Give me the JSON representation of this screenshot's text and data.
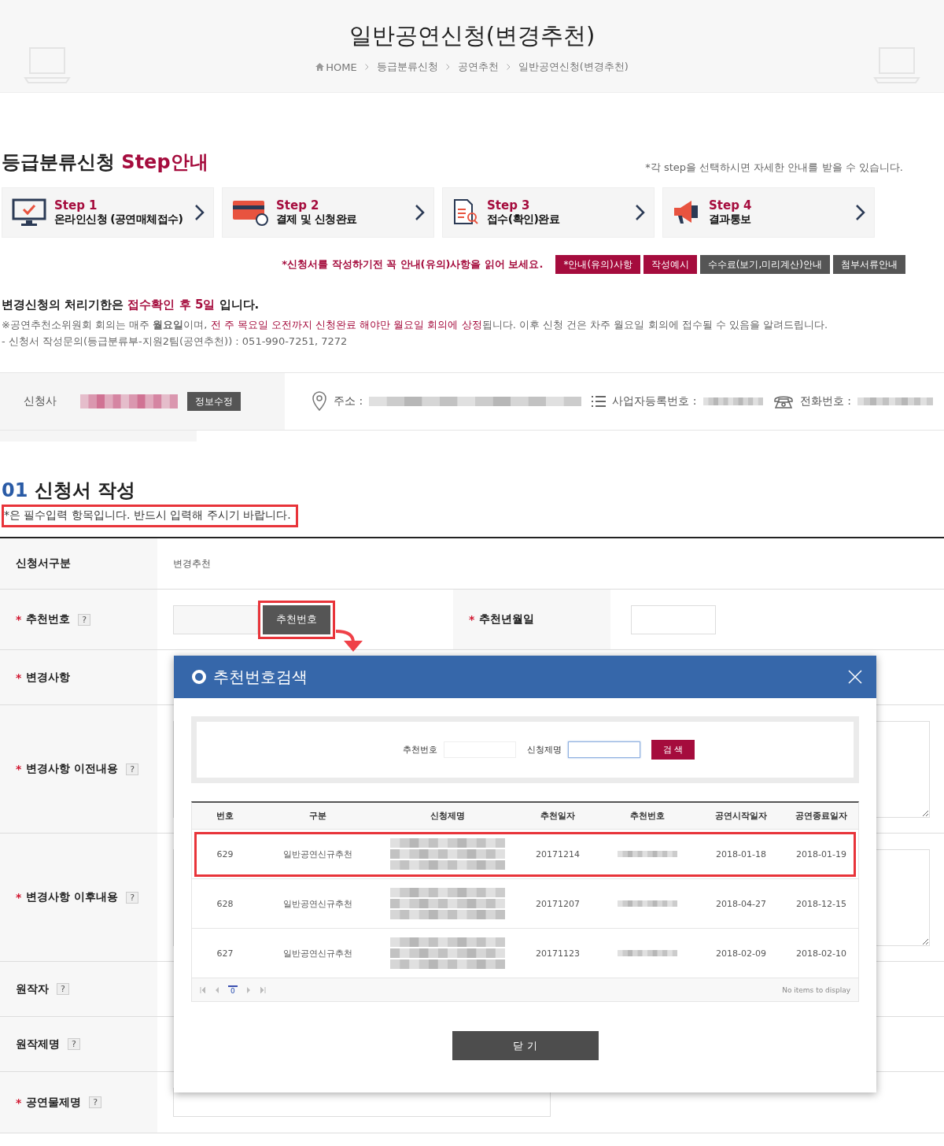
{
  "header": {
    "title": "일반공연신청(변경추천)",
    "breadcrumb": [
      "HOME",
      "등급분류신청",
      "공연추천",
      "일반공연신청(변경추천)"
    ]
  },
  "steps_section": {
    "title": "등급분류신청",
    "title_accent": "Step안내",
    "note": "*각 step을 선택하시면 자세한 안내를 받을 수 있습니다.",
    "steps": [
      {
        "kind": "monitor",
        "step": "Step 1",
        "label": "온라인신청 (공연매체접수)"
      },
      {
        "kind": "card",
        "step": "Step 2",
        "label": "결제 및 신청완료"
      },
      {
        "kind": "document",
        "step": "Step 3",
        "label": "접수(확인)완료"
      },
      {
        "kind": "megaphone",
        "step": "Step 4",
        "label": "결과통보"
      }
    ]
  },
  "notice": {
    "text": "*신청서를 작성하기전 꼭 안내(유의)사항을 읽어 보세요.",
    "buttons": [
      {
        "label": "*안내(유의)사항",
        "kind": "primary"
      },
      {
        "label": "작성예시",
        "kind": "primary"
      },
      {
        "label": "수수료(보기,미리계산)안내",
        "kind": "dark"
      },
      {
        "label": "첨부서류안내",
        "kind": "dark"
      }
    ]
  },
  "deadline": {
    "before": "변경신청의 처리기한은 ",
    "accent": "접수확인 후 5일",
    "after": " 입니다."
  },
  "info_lines": [
    {
      "segments": [
        {
          "text": "※공연추천소위원회 회의는 매주 **월요일**이며, ",
          "accent": false
        },
        {
          "text": "전 주 목요일 오전까지 신청완료 해야만 월요일 회의에 상정",
          "accent": true
        },
        {
          "text": "됩니다. 이후 신청 건은 차주 월요일 회의에 접수될 수 있음을 알려드립니다.",
          "accent": false
        }
      ]
    },
    {
      "segments": [
        {
          "text": "- 신청서 작성문의(등급분류부-지원2팀(공연추천)) : 051-990-7251, 7272",
          "accent": false
        }
      ]
    }
  ],
  "applicant": {
    "label": "신청사",
    "edit_button": "정보수정",
    "address_label": "주소 :",
    "biz_label": "사업자등록번호 :",
    "phone_label": "전화번호 :"
  },
  "form": {
    "number": "01",
    "title": "신청서 작성",
    "required_note": {
      "text": "*은 필수입력 항목입니다. 반드시 입력해 주시기 바랍니다.",
      "highlighted": true
    },
    "rows": [
      {
        "kind": "text",
        "label": "신청서구분",
        "value": "변경추천"
      },
      {
        "kind": "lookup",
        "mark": "*",
        "label": "추천번호",
        "help": "?",
        "button": {
          "label": "추천번호",
          "highlighted": true
        },
        "side_mark": "*",
        "side_label": "추천년월일"
      },
      {
        "kind": "blank",
        "mark": "*",
        "label": "변경사항"
      },
      {
        "kind": "textarea",
        "mark": "*",
        "label": "변경사항 이전내용",
        "help": "?"
      },
      {
        "kind": "textarea",
        "mark": "*",
        "label": "변경사항 이후내용",
        "help": "?"
      },
      {
        "kind": "blank",
        "label": "원작자",
        "help": "?"
      },
      {
        "kind": "blank",
        "label": "원작제명",
        "help": "?"
      },
      {
        "kind": "input",
        "mark": "*",
        "label": "공연물제명",
        "help": "?"
      }
    ]
  },
  "modal": {
    "title": "추천번호검색",
    "search": {
      "fields": [
        {
          "label": "추천번호",
          "focused": false
        },
        {
          "label": "신청제명",
          "focused": true
        }
      ],
      "button": "검 색"
    },
    "columns": [
      "번호",
      "구분",
      "신청제명",
      "추천일자",
      "추천번호",
      "공연시작일자",
      "공연종료일자"
    ],
    "rows": [
      {
        "no": "629",
        "type": "일반공연신규추천",
        "date": "20171214",
        "start": "2018-01-18",
        "end": "2018-01-19",
        "highlighted": true
      },
      {
        "no": "628",
        "type": "일반공연신규추천",
        "date": "20171207",
        "start": "2018-04-27",
        "end": "2018-12-15",
        "highlighted": false
      },
      {
        "no": "627",
        "type": "일반공연신규추천",
        "date": "20171123",
        "start": "2018-02-09",
        "end": "2018-02-10",
        "highlighted": false
      }
    ],
    "pager": {
      "page": "0",
      "status": "No items to display"
    },
    "close": "닫 기"
  }
}
